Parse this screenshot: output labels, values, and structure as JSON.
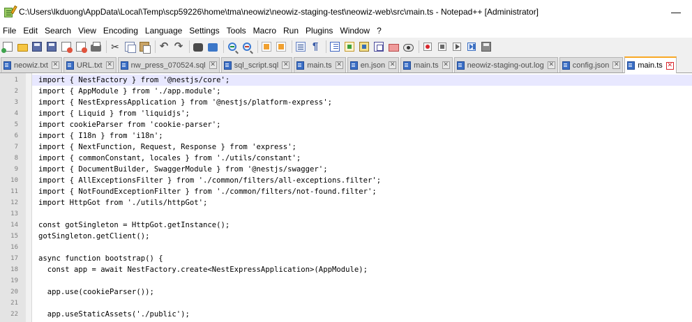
{
  "window": {
    "title": "C:\\Users\\lkduong\\AppData\\Local\\Temp\\scp59226\\home\\tma\\neowiz\\neowiz-staging-test\\neowiz-web\\src\\main.ts - Notepad++ [Administrator]",
    "minimize_glyph": "—"
  },
  "menu": [
    "File",
    "Edit",
    "Search",
    "View",
    "Encoding",
    "Language",
    "Settings",
    "Tools",
    "Macro",
    "Run",
    "Plugins",
    "Window",
    "?"
  ],
  "toolbar": {
    "buttons": [
      "new-file-icon",
      "open-folder-icon",
      "save-icon",
      "save-all-icon",
      "close-icon",
      "close-all-icon",
      "print-icon",
      "cut-icon",
      "copy-icon",
      "paste-icon",
      "undo-icon",
      "redo-icon",
      "find-icon",
      "replace-icon",
      "zoom-in-icon",
      "zoom-out-icon",
      "sync-vertical-icon",
      "sync-horizontal-icon",
      "word-wrap-icon",
      "show-all-characters-icon",
      "indent-guide-icon",
      "user-defined-language-icon",
      "document-map-icon",
      "function-list-icon",
      "folder-as-workspace-icon",
      "monitoring-icon",
      "start-recording-icon",
      "stop-recording-icon",
      "playback-icon",
      "run-macro-multiple-icon",
      "save-recorded-macro-icon"
    ],
    "cut_glyph": "✂",
    "undo_glyph": "↶",
    "redo_glyph": "↷",
    "para_glyph": "¶"
  },
  "tabs": [
    {
      "label": "neowiz.txt",
      "active": false
    },
    {
      "label": "URL.txt",
      "active": false
    },
    {
      "label": "nw_press_070524.sql",
      "active": false
    },
    {
      "label": "sql_script.sql",
      "active": false
    },
    {
      "label": "main.ts",
      "active": false
    },
    {
      "label": "en.json",
      "active": false
    },
    {
      "label": "main.ts",
      "active": false
    },
    {
      "label": "neowiz-staging-out.log",
      "active": false
    },
    {
      "label": "config.json",
      "active": false
    },
    {
      "label": "main.ts",
      "active": true
    }
  ],
  "tab_close_glyph": "✕",
  "editor": {
    "current_line": 1,
    "lines": [
      {
        "n": "1",
        "text": "import { NestFactory } from '@nestjs/core';"
      },
      {
        "n": "2",
        "text": "import { AppModule } from './app.module';"
      },
      {
        "n": "3",
        "text": "import { NestExpressApplication } from '@nestjs/platform-express';"
      },
      {
        "n": "4",
        "text": "import { Liquid } from 'liquidjs';"
      },
      {
        "n": "5",
        "text": "import cookieParser from 'cookie-parser';"
      },
      {
        "n": "6",
        "text": "import { I18n } from 'i18n';"
      },
      {
        "n": "7",
        "text": "import { NextFunction, Request, Response } from 'express';"
      },
      {
        "n": "8",
        "text": "import { commonConstant, locales } from './utils/constant';"
      },
      {
        "n": "9",
        "text": "import { DocumentBuilder, SwaggerModule } from '@nestjs/swagger';"
      },
      {
        "n": "10",
        "text": "import { AllExceptionsFilter } from './common/filters/all-exceptions.filter';"
      },
      {
        "n": "11",
        "text": "import { NotFoundExceptionFilter } from './common/filters/not-found.filter';"
      },
      {
        "n": "12",
        "text": "import HttpGot from './utils/httpGot';"
      },
      {
        "n": "13",
        "text": ""
      },
      {
        "n": "14",
        "text": "const gotSingleton = HttpGot.getInstance();"
      },
      {
        "n": "15",
        "text": "gotSingleton.getClient();"
      },
      {
        "n": "16",
        "text": ""
      },
      {
        "n": "17",
        "text": "async function bootstrap() {"
      },
      {
        "n": "18",
        "text": "  const app = await NestFactory.create<NestExpressApplication>(AppModule);"
      },
      {
        "n": "19",
        "text": ""
      },
      {
        "n": "20",
        "text": "  app.use(cookieParser());"
      },
      {
        "n": "21",
        "text": ""
      },
      {
        "n": "22",
        "text": "  app.useStaticAssets('./public');"
      }
    ]
  }
}
